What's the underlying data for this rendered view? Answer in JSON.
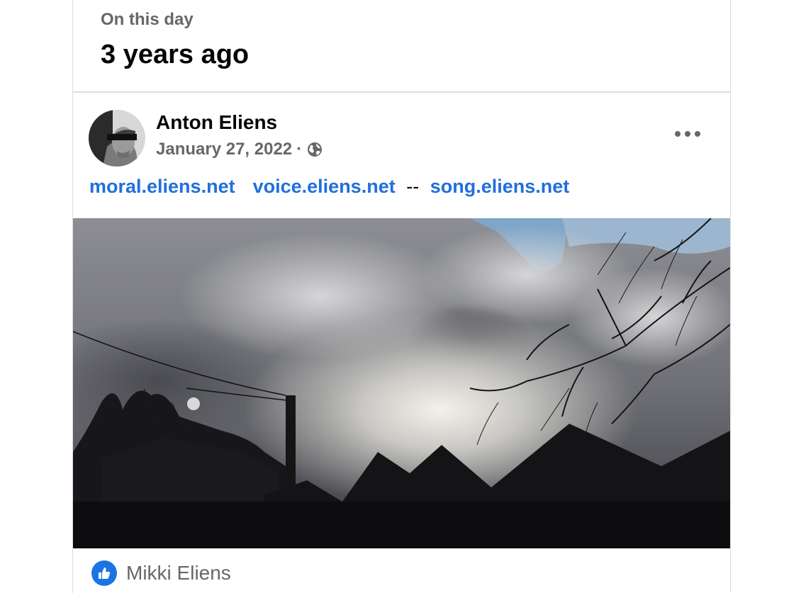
{
  "memory": {
    "label": "On this day",
    "time_ago": "3 years ago"
  },
  "post": {
    "author": "Anton Eliens",
    "date": "January 27, 2022",
    "separator": "·",
    "audience_icon": "globe-icon",
    "links": [
      {
        "text": "moral.eliens.net"
      },
      {
        "text": "voice.eliens.net"
      },
      {
        "text": "song.eliens.net"
      }
    ],
    "dash": "--",
    "photo_description_icon": "photo"
  },
  "reactions": {
    "icon": "like-icon",
    "names": "Mikki Eliens"
  },
  "colors": {
    "link": "#216fdb",
    "secondary_text": "#65676b",
    "like_blue": "#1b74e4"
  }
}
